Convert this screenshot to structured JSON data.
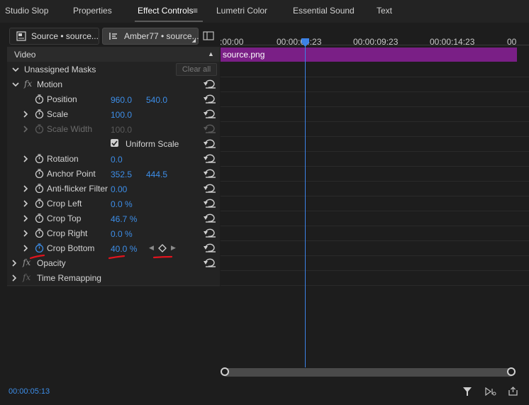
{
  "tabs": [
    {
      "label": "Studio Slop"
    },
    {
      "label": "Properties"
    },
    {
      "label": "Effect Controls",
      "active": true
    },
    {
      "label": "Lumetri Color"
    },
    {
      "label": "Essential Sound"
    },
    {
      "label": "Text"
    }
  ],
  "source_bar": {
    "source_label": "Source • source...",
    "sequence_label": "Amber77 • source..."
  },
  "panel": {
    "section_title": "Video",
    "unassigned_masks": "Unassigned Masks",
    "clear_all": "Clear all"
  },
  "effects": {
    "motion": "Motion",
    "opacity": "Opacity",
    "time_remapping": "Time Remapping"
  },
  "properties": [
    {
      "name": "Position",
      "v1": "960.0",
      "v2": "540.0"
    },
    {
      "name": "Scale",
      "v1": "100.0"
    },
    {
      "name": "Scale Width",
      "v1": "100.0",
      "disabled": true
    },
    {
      "name": "Uniform Scale",
      "checked": true
    },
    {
      "name": "Rotation",
      "v1": "0.0"
    },
    {
      "name": "Anchor Point",
      "v1": "352.5",
      "v2": "444.5"
    },
    {
      "name": "Anti-flicker Filter",
      "v1": "0.00"
    },
    {
      "name": "Crop Left",
      "v1": "0.0 %"
    },
    {
      "name": "Crop Top",
      "v1": "46.7 %"
    },
    {
      "name": "Crop Right",
      "v1": "0.0 %"
    },
    {
      "name": "Crop Bottom",
      "v1": "40.0 %",
      "keyframed": true
    }
  ],
  "timeline": {
    "ticks": [
      ":00:00",
      "00:00:04:23",
      "00:00:09:23",
      "00:00:14:23",
      "00"
    ],
    "clip_name": "source.png",
    "timecode": "00:00:05:13"
  },
  "colors": {
    "accent": "#3d8ee8",
    "clip": "#7a1f86",
    "annotation": "#e0141e"
  },
  "icons": [
    "stopwatch-icon",
    "reset-icon",
    "fx-icon",
    "chevron-right-icon",
    "chevron-down-icon",
    "filter-icon",
    "playback-icon",
    "export-icon",
    "keyframe-diamond-icon",
    "panel-menu-icon"
  ]
}
